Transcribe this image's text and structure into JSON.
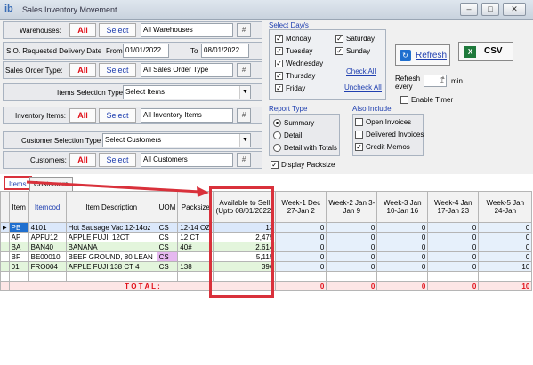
{
  "window": {
    "title": "Sales Inventory Movement",
    "logo": "ib",
    "minimize": "–",
    "restore": "□",
    "close": "✕"
  },
  "filters": {
    "warehouses": {
      "label": "Warehouses:",
      "all": "All",
      "select": "Select",
      "value": "All Warehouses"
    },
    "delivery_date": {
      "label": "S.O. Requested Delivery Date",
      "from_label": "From",
      "from": "01/01/2022",
      "to_label": "To",
      "to": "08/01/2022"
    },
    "so_type": {
      "label": "Sales Order Type:",
      "all": "All",
      "select": "Select",
      "value": "All Sales Order Type"
    },
    "item_selection": {
      "label": "Items Selection Type",
      "value": "Select Items"
    },
    "inventory_items": {
      "label": "Inventory Items:",
      "all": "All",
      "select": "Select",
      "value": "All Inventory Items"
    },
    "customer_selection": {
      "label": "Customer Selection Type",
      "value": "Select Customers"
    },
    "customers": {
      "label": "Customers:",
      "all": "All",
      "select": "Select",
      "value": "All Customers"
    },
    "hash": "#"
  },
  "days": {
    "title": "Select Day/s",
    "items": [
      {
        "label": "Monday",
        "checked": true
      },
      {
        "label": "Tuesday",
        "checked": true
      },
      {
        "label": "Wednesday",
        "checked": true
      },
      {
        "label": "Thursday",
        "checked": true
      },
      {
        "label": "Friday",
        "checked": true
      },
      {
        "label": "Saturday",
        "checked": true
      },
      {
        "label": "Sunday",
        "checked": true
      }
    ],
    "check_all": "Check All",
    "uncheck_all": "Uncheck All"
  },
  "actions": {
    "refresh": "Refresh",
    "csv": "CSV",
    "refresh_every": "Refresh every",
    "interval": "1",
    "unit": "min.",
    "enable_timer": "Enable Timer"
  },
  "report_type": {
    "title": "Report Type",
    "options": [
      "Summary",
      "Detail",
      "Detail with Totals"
    ],
    "selected": 0
  },
  "also_include": {
    "title": "Also Include",
    "options": [
      {
        "label": "Open Invoices",
        "checked": false
      },
      {
        "label": "Delivered Invoices",
        "checked": false
      },
      {
        "label": "Credit Memos",
        "checked": true
      }
    ]
  },
  "display_packsize": {
    "label": "Display Packsize",
    "checked": true
  },
  "tabs": [
    "Items",
    "Customers"
  ],
  "grid": {
    "columns": [
      "Item",
      "Itemcod",
      "Item Description",
      "UOM",
      "Packsize",
      "Available to Sell (Upto 08/01/2022)",
      "Week-1 Dec 27-Jan 2",
      "Week-2 Jan 3-Jan 9",
      "Week-3 Jan 10-Jan 16",
      "Week-4 Jan 17-Jan 23",
      "Week-5 Jan 24-Jan"
    ],
    "rows": [
      [
        "PB",
        "4101",
        "Hot Sausage Vac 12-14oz",
        "CS",
        "12-14 OZ",
        "13",
        "0",
        "0",
        "0",
        "0",
        "0"
      ],
      [
        "AP",
        "APFU12",
        "APPLE FUJI, 12CT",
        "CS",
        "12 CT",
        "2,475",
        "0",
        "0",
        "0",
        "0",
        "0"
      ],
      [
        "BA",
        "BAN40",
        "BANANA",
        "CS",
        "40#",
        "2,614",
        "0",
        "0",
        "0",
        "0",
        "0"
      ],
      [
        "BF",
        "BE00010",
        "BEEF GROUND, 80 LEAN",
        "CS",
        "",
        "5,115",
        "0",
        "0",
        "0",
        "0",
        "0"
      ],
      [
        "01",
        "FRO004",
        "APPLE FUJI 138 CT 4",
        "CS",
        "138",
        "396",
        "0",
        "0",
        "0",
        "0",
        "10"
      ]
    ],
    "total_label": "T O T A L :",
    "totals": [
      "0",
      "0",
      "0",
      "0",
      "10"
    ]
  }
}
